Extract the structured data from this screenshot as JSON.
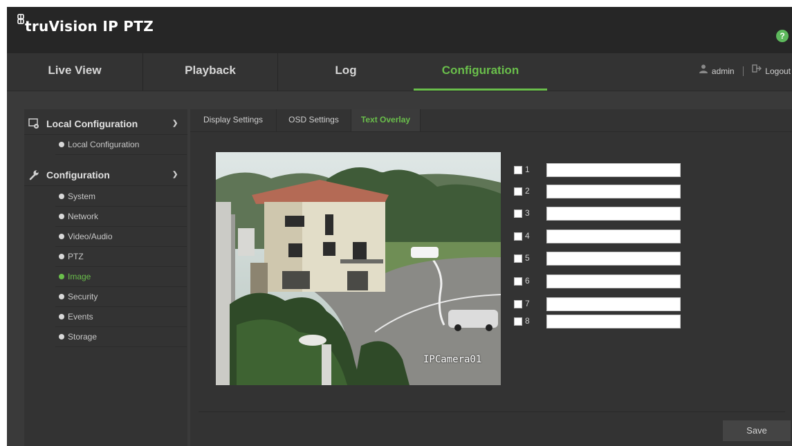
{
  "app": {
    "title": "truVision IP PTZ",
    "help_icon": "?",
    "accent_color": "#6abf4b"
  },
  "nav": {
    "tabs": [
      {
        "label": "Live View"
      },
      {
        "label": "Playback"
      },
      {
        "label": "Log"
      },
      {
        "label": "Configuration",
        "active": true
      }
    ],
    "user": "admin",
    "logout": "Logout"
  },
  "sidebar": {
    "sections": [
      {
        "label": "Local Configuration",
        "icon": "local-config-icon",
        "items": [
          {
            "label": "Local Configuration"
          }
        ]
      },
      {
        "label": "Configuration",
        "icon": "wrench-icon",
        "items": [
          {
            "label": "System"
          },
          {
            "label": "Network"
          },
          {
            "label": "Video/Audio"
          },
          {
            "label": "PTZ"
          },
          {
            "label": "Image",
            "active": true
          },
          {
            "label": "Security"
          },
          {
            "label": "Events"
          },
          {
            "label": "Storage"
          }
        ]
      }
    ]
  },
  "subtabs": [
    {
      "label": "Display Settings"
    },
    {
      "label": "OSD Settings"
    },
    {
      "label": "Text Overlay",
      "active": true
    }
  ],
  "preview": {
    "osd_text": "IPCamera01"
  },
  "overlays": [
    {
      "num": "1",
      "checked": false,
      "text": ""
    },
    {
      "num": "2",
      "checked": false,
      "text": ""
    },
    {
      "num": "3",
      "checked": false,
      "text": ""
    },
    {
      "num": "4",
      "checked": false,
      "text": ""
    },
    {
      "num": "5",
      "checked": false,
      "text": ""
    },
    {
      "num": "6",
      "checked": false,
      "text": ""
    },
    {
      "num": "7",
      "checked": false,
      "text": ""
    },
    {
      "num": "8",
      "checked": false,
      "text": ""
    }
  ],
  "save_label": "Save"
}
